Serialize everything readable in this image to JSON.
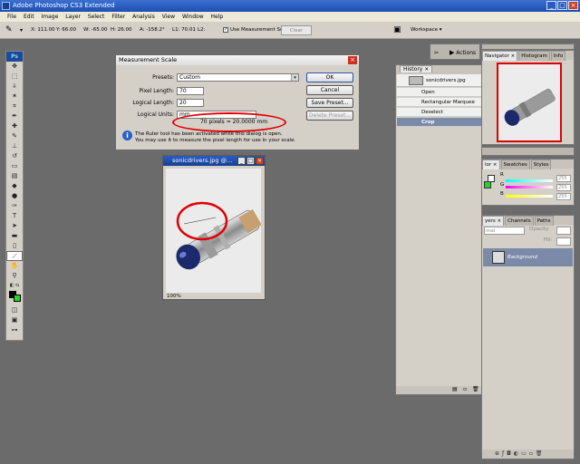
{
  "app": {
    "title": "Adobe Photoshop CS3 Extended",
    "menu": [
      "File",
      "Edit",
      "Image",
      "Layer",
      "Select",
      "Filter",
      "Analysis",
      "View",
      "Window",
      "Help"
    ]
  },
  "options_bar": {
    "x": "X: 111.00",
    "y": "Y: 66.00",
    "w": "W: -65.00",
    "h": "H: 26.00",
    "a": "A: -158.2°",
    "l1": "L1: 70.01",
    "l2": "L2:",
    "use_measurement_scale": "Use Measurement Scale",
    "use_measurement_scale_checked": true,
    "clear": "Clear",
    "workspace": "Workspace ▾"
  },
  "toolbox": {
    "logo": "Ps",
    "foreground_color": "#000000",
    "background_color": "#23d623"
  },
  "measurement_dialog": {
    "title": "Measurement Scale",
    "presets_label": "Presets:",
    "presets_value": "Custom",
    "pixel_length_label": "Pixel Length:",
    "pixel_length_value": "70",
    "logical_length_label": "Logical Length:",
    "logical_length_value": "20",
    "logical_units_label": "Logical Units:",
    "logical_units_value": "mm",
    "result": "70 pixels = 20.0000 mm",
    "ok": "OK",
    "cancel": "Cancel",
    "save_preset": "Save Preset...",
    "delete_preset": "Delete Preset...",
    "message_line1": "The Ruler tool has been activated while this dialog is open.",
    "message_line2": "You may use it to measure the pixel length for use in your scale."
  },
  "document": {
    "title": "sonicdrivers.jpg @...",
    "zoom": "100%"
  },
  "history": {
    "tab": "History ×",
    "snapshot": "sonicdrivers.jpg",
    "steps": [
      "Open",
      "Rectangular Marquee",
      "Deselect",
      "Crop"
    ],
    "selected_step": "Crop"
  },
  "panels": {
    "actions_tab": "Actions",
    "navigator_tabs": [
      "Navigator ×",
      "Histogram",
      "Info"
    ],
    "color_tabs": [
      "lor ×",
      "Swatches",
      "Styles"
    ],
    "color_values": [
      "255",
      "255",
      "255"
    ],
    "color_labels": [
      "R",
      "G",
      "B"
    ],
    "layers_tabs": [
      "yers ×",
      "Channels",
      "Paths"
    ],
    "layers_blend": "mal",
    "layers_opacity_label": "Opacity:",
    "layers_fill_label": "Fill:",
    "layer_name": "Background"
  }
}
